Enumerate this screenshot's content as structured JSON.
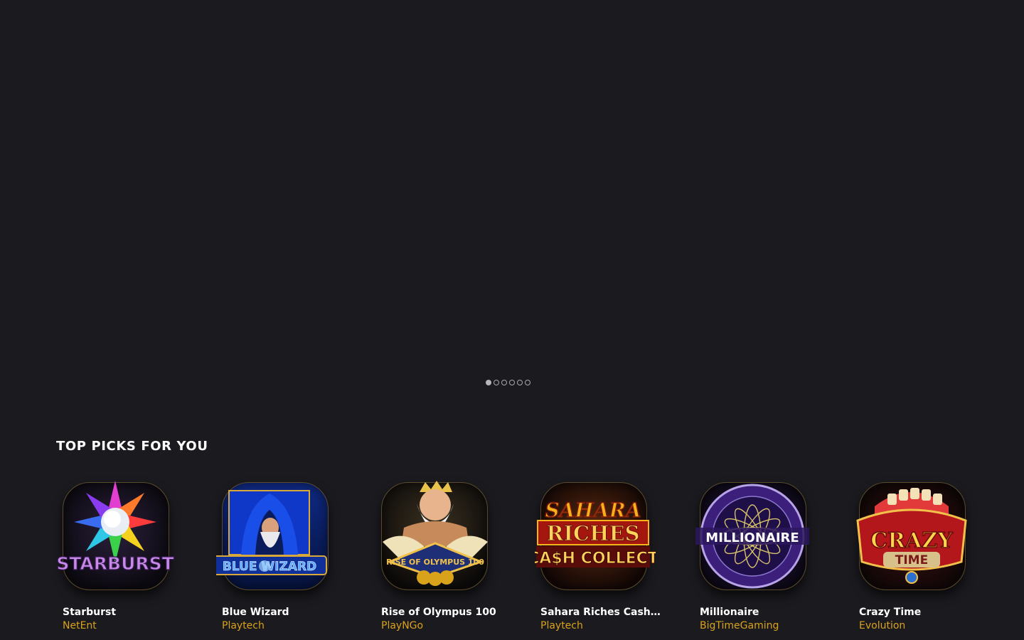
{
  "hero": {
    "carousel_slide_count": 6,
    "carousel_active_index": 0
  },
  "section": {
    "title": "TOP PICKS FOR YOU"
  },
  "games": [
    {
      "name": "Starburst",
      "provider": "NetEnt",
      "logo_text": "STARBURST",
      "logo_color": "#c78ae8"
    },
    {
      "name": "Blue Wizard",
      "provider": "Playtech",
      "logo_text": "BLUE WIZARD",
      "logo_color": "#5aa8ff"
    },
    {
      "name": "Rise of Olympus 100",
      "provider": "PlayNGo",
      "logo_text": "RISE OF OLYMPUS 100",
      "logo_color": "#f0c14a"
    },
    {
      "name": "Sahara Riches Cash Collect",
      "provider": "Playtech",
      "logo_text": "SAHARA RICHES CASH COLLECT",
      "logo_color": "#f7b21b"
    },
    {
      "name": "Millionaire",
      "provider": "BigTimeGaming",
      "logo_text": "MILLIONAIRE",
      "logo_color": "#ffffff"
    },
    {
      "name": "Crazy Time",
      "provider": "Evolution",
      "logo_text": "CRAZY TIME",
      "logo_color": "#ffd54a"
    }
  ],
  "colors": {
    "background": "#1b1a1f",
    "provider_text": "#d9a21b",
    "heading_text": "#ffffff"
  }
}
